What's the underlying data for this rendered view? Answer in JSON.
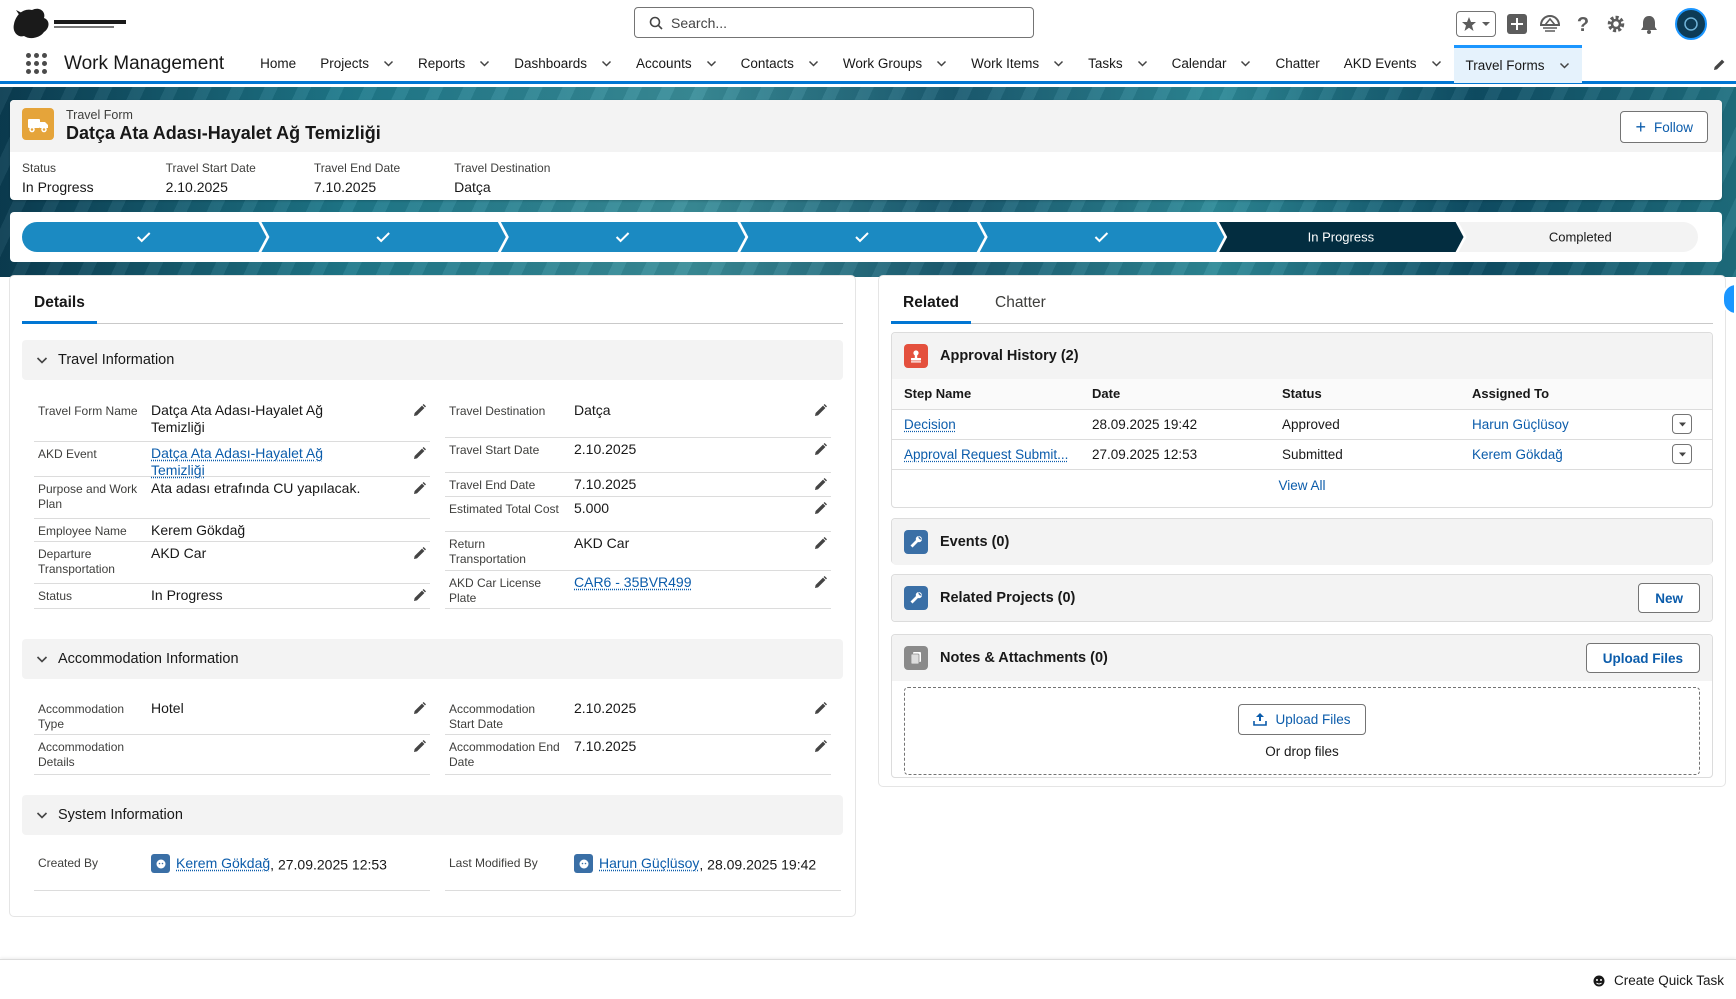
{
  "header": {
    "search_placeholder": "Search...",
    "colors": {
      "brand": "#0176d3",
      "link": "#0b5cab"
    }
  },
  "nav": {
    "app_name": "Work Management",
    "items": [
      {
        "label": "Home",
        "chevron": false
      },
      {
        "label": "Projects",
        "chevron": true
      },
      {
        "label": "Reports",
        "chevron": true
      },
      {
        "label": "Dashboards",
        "chevron": true
      },
      {
        "label": "Accounts",
        "chevron": true
      },
      {
        "label": "Contacts",
        "chevron": true
      },
      {
        "label": "Work Groups",
        "chevron": true
      },
      {
        "label": "Work Items",
        "chevron": true
      },
      {
        "label": "Tasks",
        "chevron": true
      },
      {
        "label": "Calendar",
        "chevron": true
      },
      {
        "label": "Chatter",
        "chevron": false
      },
      {
        "label": "AKD Events",
        "chevron": true
      },
      {
        "label": "Travel Forms",
        "chevron": true,
        "active": true
      }
    ]
  },
  "record": {
    "type": "Travel Form",
    "title": "Datça Ata Adası-Hayalet Ağ Temizliği",
    "follow_label": "Follow",
    "highlights": [
      {
        "label": "Status",
        "value": "In Progress"
      },
      {
        "label": "Travel Start Date",
        "value": "2.10.2025"
      },
      {
        "label": "Travel End Date",
        "value": "7.10.2025"
      },
      {
        "label": "Travel Destination",
        "value": "Datça"
      }
    ]
  },
  "path": {
    "steps": [
      {
        "label": "",
        "state": "complete"
      },
      {
        "label": "",
        "state": "complete"
      },
      {
        "label": "",
        "state": "complete"
      },
      {
        "label": "",
        "state": "complete"
      },
      {
        "label": "",
        "state": "complete"
      },
      {
        "label": "In Progress",
        "state": "current"
      },
      {
        "label": "Completed",
        "state": "incomplete"
      }
    ]
  },
  "details": {
    "tab": "Details",
    "sections": {
      "travel": {
        "title": "Travel Information",
        "left": [
          {
            "label": "Travel Form Name",
            "value": "Datça Ata Adası-Hayalet Ağ Temizliği"
          },
          {
            "label": "AKD Event",
            "value": "Datça Ata Adası-Hayalet Ağ Temizliği"
          },
          {
            "label": "Purpose and Work Plan",
            "value": "Ata adası etrafında CU yapılacak."
          },
          {
            "label": "Employee Name",
            "value": "Kerem Gökdağ"
          },
          {
            "label": "Departure Transportation",
            "value": "AKD Car"
          },
          {
            "label": "Status",
            "value": "In Progress"
          }
        ],
        "right": [
          {
            "label": "Travel Destination",
            "value": "Datça"
          },
          {
            "label": "Travel Start Date",
            "value": "2.10.2025"
          },
          {
            "label": "Travel End Date",
            "value": "7.10.2025"
          },
          {
            "label": "Estimated Total Cost",
            "value": "5.000"
          },
          {
            "label": "Return Transportation",
            "value": "AKD Car"
          },
          {
            "label": "AKD Car License Plate",
            "value": "CAR6 - 35BVR499"
          }
        ]
      },
      "accommodation": {
        "title": "Accommodation Information",
        "left": [
          {
            "label": "Accommodation Type",
            "value": "Hotel"
          },
          {
            "label": "Accommodation Details",
            "value": ""
          }
        ],
        "right": [
          {
            "label": "Accommodation Start Date",
            "value": "2.10.2025"
          },
          {
            "label": "Accommodation End Date",
            "value": "7.10.2025"
          }
        ]
      },
      "system": {
        "title": "System Information",
        "created_by": {
          "label": "Created By",
          "user": "Kerem Gökdağ",
          "date": ", 27.09.2025 12:53"
        },
        "modified_by": {
          "label": "Last Modified By",
          "user": "Harun Güçlüsoy",
          "date": ", 28.09.2025 19:42"
        }
      }
    }
  },
  "related": {
    "tabs": [
      "Related",
      "Chatter"
    ],
    "approval": {
      "title": "Approval History (2)",
      "columns": [
        "Step Name",
        "Date",
        "Status",
        "Assigned To"
      ],
      "rows": [
        {
          "step": "Decision",
          "date": "28.09.2025 19:42",
          "status": "Approved",
          "assigned": "Harun Güçlüsoy"
        },
        {
          "step": "Approval Request Submit...",
          "date": "27.09.2025 12:53",
          "status": "Submitted",
          "assigned": "Kerem Gökdağ"
        }
      ],
      "view_all": "View All"
    },
    "events": {
      "title": "Events (0)"
    },
    "projects": {
      "title": "Related Projects (0)",
      "button": "New"
    },
    "notes": {
      "title": "Notes & Attachments (0)",
      "button": "Upload Files",
      "upload_label": "Upload Files",
      "drop_text": "Or drop files"
    }
  },
  "utility": {
    "quick_task": "Create Quick Task"
  }
}
